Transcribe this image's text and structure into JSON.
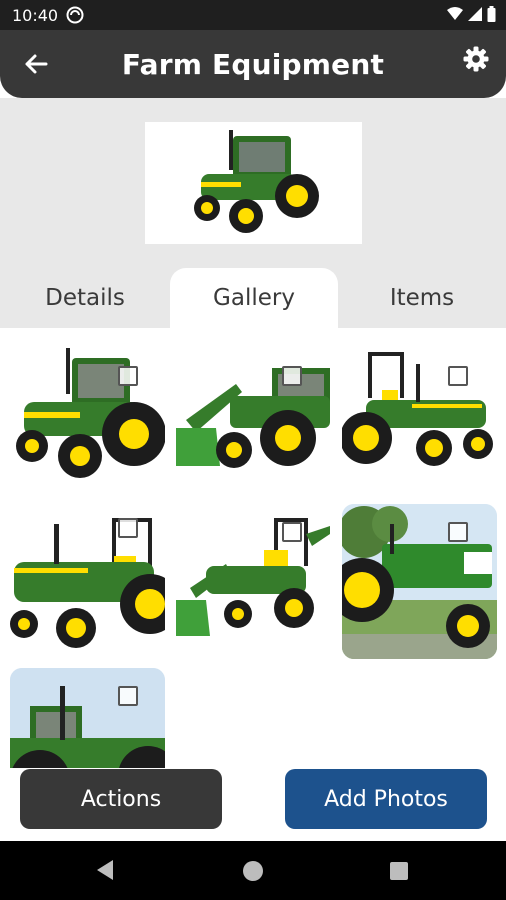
{
  "status_bar": {
    "time": "10:40"
  },
  "app_bar": {
    "title": "Farm Equipment",
    "icons": [
      "back-arrow-icon",
      "gear-icon"
    ]
  },
  "header": {
    "image": "tractor-photo"
  },
  "tabs": [
    {
      "label": "Details",
      "selected": false
    },
    {
      "label": "Gallery",
      "selected": true
    },
    {
      "label": "Items",
      "selected": false
    }
  ],
  "gallery": {
    "items": [
      {
        "image": "green-tractor-cab",
        "checked": false
      },
      {
        "image": "green-tractor-front-loader",
        "checked": false
      },
      {
        "image": "green-utility-tractor",
        "checked": false
      },
      {
        "image": "green-compact-tractor",
        "checked": false
      },
      {
        "image": "green-tractor-loader-backhoe",
        "checked": false
      },
      {
        "image": "vintage-green-tractor",
        "checked": false
      },
      {
        "image": "green-large-tractor",
        "checked": false
      }
    ]
  },
  "buttons": {
    "actions_label": "Actions",
    "add_photos_label": "Add Photos"
  },
  "colors": {
    "app_bar": "#383838",
    "accent_button": "#1d528d",
    "tractor_green": "#367c2b",
    "tractor_yellow": "#ffde00"
  }
}
